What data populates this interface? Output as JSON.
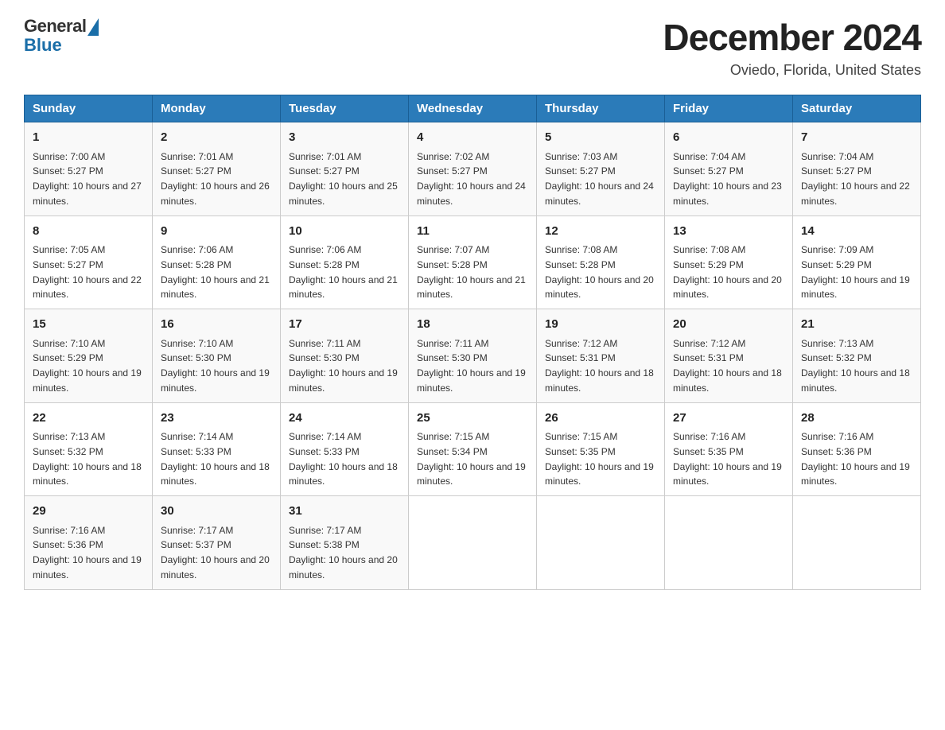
{
  "logo": {
    "general": "General",
    "blue": "Blue"
  },
  "header": {
    "month": "December 2024",
    "location": "Oviedo, Florida, United States"
  },
  "days_of_week": [
    "Sunday",
    "Monday",
    "Tuesday",
    "Wednesday",
    "Thursday",
    "Friday",
    "Saturday"
  ],
  "weeks": [
    [
      {
        "day": "1",
        "sunrise": "7:00 AM",
        "sunset": "5:27 PM",
        "daylight": "10 hours and 27 minutes."
      },
      {
        "day": "2",
        "sunrise": "7:01 AM",
        "sunset": "5:27 PM",
        "daylight": "10 hours and 26 minutes."
      },
      {
        "day": "3",
        "sunrise": "7:01 AM",
        "sunset": "5:27 PM",
        "daylight": "10 hours and 25 minutes."
      },
      {
        "day": "4",
        "sunrise": "7:02 AM",
        "sunset": "5:27 PM",
        "daylight": "10 hours and 24 minutes."
      },
      {
        "day": "5",
        "sunrise": "7:03 AM",
        "sunset": "5:27 PM",
        "daylight": "10 hours and 24 minutes."
      },
      {
        "day": "6",
        "sunrise": "7:04 AM",
        "sunset": "5:27 PM",
        "daylight": "10 hours and 23 minutes."
      },
      {
        "day": "7",
        "sunrise": "7:04 AM",
        "sunset": "5:27 PM",
        "daylight": "10 hours and 22 minutes."
      }
    ],
    [
      {
        "day": "8",
        "sunrise": "7:05 AM",
        "sunset": "5:27 PM",
        "daylight": "10 hours and 22 minutes."
      },
      {
        "day": "9",
        "sunrise": "7:06 AM",
        "sunset": "5:28 PM",
        "daylight": "10 hours and 21 minutes."
      },
      {
        "day": "10",
        "sunrise": "7:06 AM",
        "sunset": "5:28 PM",
        "daylight": "10 hours and 21 minutes."
      },
      {
        "day": "11",
        "sunrise": "7:07 AM",
        "sunset": "5:28 PM",
        "daylight": "10 hours and 21 minutes."
      },
      {
        "day": "12",
        "sunrise": "7:08 AM",
        "sunset": "5:28 PM",
        "daylight": "10 hours and 20 minutes."
      },
      {
        "day": "13",
        "sunrise": "7:08 AM",
        "sunset": "5:29 PM",
        "daylight": "10 hours and 20 minutes."
      },
      {
        "day": "14",
        "sunrise": "7:09 AM",
        "sunset": "5:29 PM",
        "daylight": "10 hours and 19 minutes."
      }
    ],
    [
      {
        "day": "15",
        "sunrise": "7:10 AM",
        "sunset": "5:29 PM",
        "daylight": "10 hours and 19 minutes."
      },
      {
        "day": "16",
        "sunrise": "7:10 AM",
        "sunset": "5:30 PM",
        "daylight": "10 hours and 19 minutes."
      },
      {
        "day": "17",
        "sunrise": "7:11 AM",
        "sunset": "5:30 PM",
        "daylight": "10 hours and 19 minutes."
      },
      {
        "day": "18",
        "sunrise": "7:11 AM",
        "sunset": "5:30 PM",
        "daylight": "10 hours and 19 minutes."
      },
      {
        "day": "19",
        "sunrise": "7:12 AM",
        "sunset": "5:31 PM",
        "daylight": "10 hours and 18 minutes."
      },
      {
        "day": "20",
        "sunrise": "7:12 AM",
        "sunset": "5:31 PM",
        "daylight": "10 hours and 18 minutes."
      },
      {
        "day": "21",
        "sunrise": "7:13 AM",
        "sunset": "5:32 PM",
        "daylight": "10 hours and 18 minutes."
      }
    ],
    [
      {
        "day": "22",
        "sunrise": "7:13 AM",
        "sunset": "5:32 PM",
        "daylight": "10 hours and 18 minutes."
      },
      {
        "day": "23",
        "sunrise": "7:14 AM",
        "sunset": "5:33 PM",
        "daylight": "10 hours and 18 minutes."
      },
      {
        "day": "24",
        "sunrise": "7:14 AM",
        "sunset": "5:33 PM",
        "daylight": "10 hours and 18 minutes."
      },
      {
        "day": "25",
        "sunrise": "7:15 AM",
        "sunset": "5:34 PM",
        "daylight": "10 hours and 19 minutes."
      },
      {
        "day": "26",
        "sunrise": "7:15 AM",
        "sunset": "5:35 PM",
        "daylight": "10 hours and 19 minutes."
      },
      {
        "day": "27",
        "sunrise": "7:16 AM",
        "sunset": "5:35 PM",
        "daylight": "10 hours and 19 minutes."
      },
      {
        "day": "28",
        "sunrise": "7:16 AM",
        "sunset": "5:36 PM",
        "daylight": "10 hours and 19 minutes."
      }
    ],
    [
      {
        "day": "29",
        "sunrise": "7:16 AM",
        "sunset": "5:36 PM",
        "daylight": "10 hours and 19 minutes."
      },
      {
        "day": "30",
        "sunrise": "7:17 AM",
        "sunset": "5:37 PM",
        "daylight": "10 hours and 20 minutes."
      },
      {
        "day": "31",
        "sunrise": "7:17 AM",
        "sunset": "5:38 PM",
        "daylight": "10 hours and 20 minutes."
      },
      null,
      null,
      null,
      null
    ]
  ]
}
